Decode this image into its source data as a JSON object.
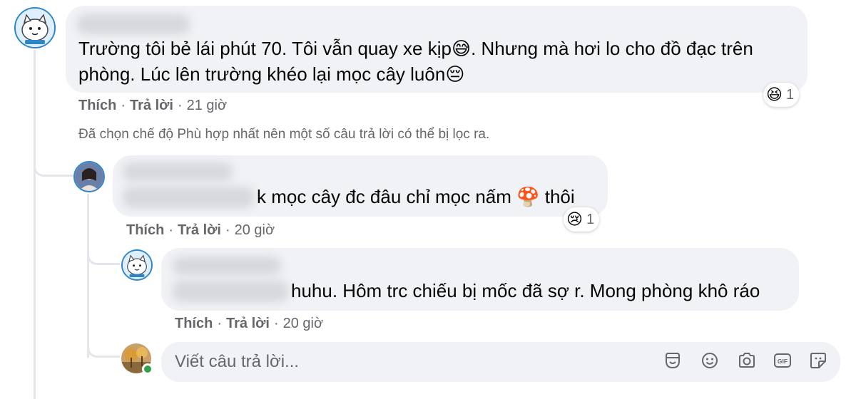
{
  "comment1": {
    "text_line1": "Trường tôi bẻ lái phút 70. Tôi vẫn quay xe kịp😅. Nhưng mà hơi lo cho đồ đạc trên",
    "text_line2": "phòng. Lúc lên trường khéo lại mọc cây luôn😔",
    "like": "Thích",
    "reply": "Trả lời",
    "time": "21 giờ",
    "reaction_count": "1",
    "reaction_emoji": "😆"
  },
  "filter_note": "Đã chọn chế độ Phù hợp nhất nên một số câu trả lời có thể bị lọc ra.",
  "reply1": {
    "text": "k mọc cây đc đâu chỉ mọc nấm 🍄 thôi",
    "like": "Thích",
    "reply": "Trả lời",
    "time": "20 giờ",
    "reaction_count": "1",
    "reaction_emoji": "😢"
  },
  "reply2": {
    "text": "huhu. Hôm trc chiếu bị mốc đã sợ r. Mong phòng khô ráo",
    "like": "Thích",
    "reply": "Trả lời",
    "time": "20 giờ"
  },
  "reply_input": {
    "placeholder": "Viết câu trả lời...",
    "tools": [
      "avatar-sticker-icon",
      "emoji-icon",
      "camera-icon",
      "gif-icon",
      "sticker-icon"
    ]
  },
  "separator": "·",
  "colors": {
    "bubble": "#f0f2f5",
    "meta": "#65676b",
    "text": "#050505",
    "online": "#31a24c"
  }
}
